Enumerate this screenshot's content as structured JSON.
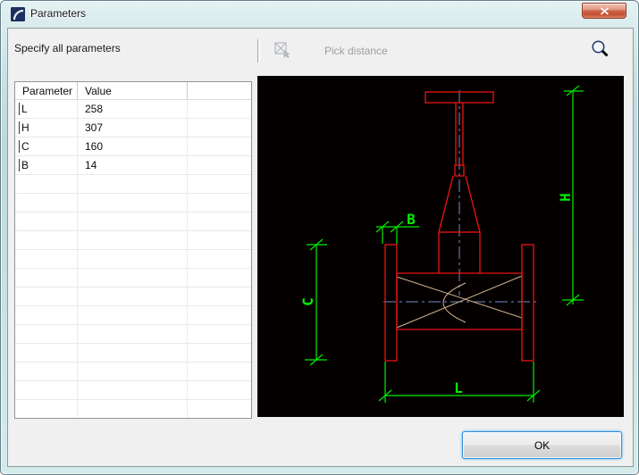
{
  "window": {
    "title": "Parameters"
  },
  "toolbar": {
    "instruction": "Specify all parameters",
    "pick_distance_label": "Pick distance"
  },
  "table": {
    "columns": {
      "parameter": "Parameter",
      "value": "Value",
      "extra": ""
    },
    "rows": [
      {
        "name": "L",
        "value": "258"
      },
      {
        "name": "H",
        "value": "307"
      },
      {
        "name": "C",
        "value": "160"
      },
      {
        "name": "B",
        "value": "14"
      }
    ],
    "empty_row_count": 13
  },
  "drawing": {
    "labels": {
      "h": "H",
      "b": "B",
      "c": "C",
      "l": "L"
    },
    "colors": {
      "background": "#050000",
      "outline": "#ec1313",
      "dimension": "#00ee00",
      "centerline": "#6e8cc8",
      "wedge": "#d2b48c"
    }
  },
  "footer": {
    "ok_label": "OK"
  }
}
